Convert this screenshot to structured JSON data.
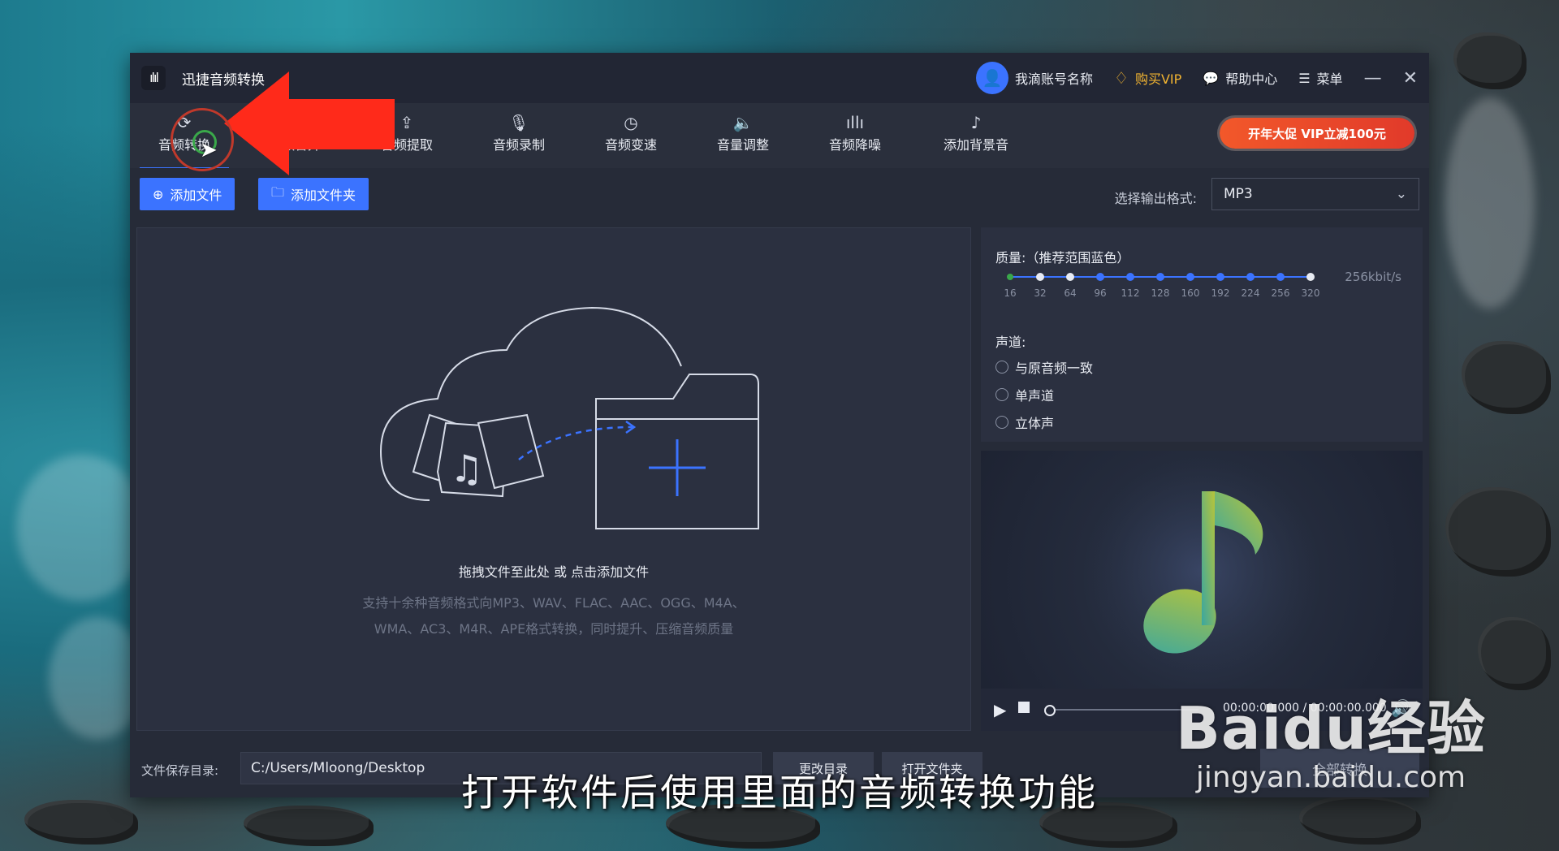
{
  "window": {
    "app_title": "迅捷音频转换",
    "account_name": "我滴账号名称",
    "vip_label": "购买VIP",
    "help_label": "帮助中心",
    "menu_label": "菜单",
    "minimize_symbol": "—",
    "close_symbol": "✕"
  },
  "toolbar": {
    "tools": [
      {
        "label": "音频转换",
        "icon": "refresh-icon"
      },
      {
        "label": "音频合并",
        "icon": "merge-icon"
      },
      {
        "label": "音频提取",
        "icon": "upload-icon"
      },
      {
        "label": "音频录制",
        "icon": "microphone-icon"
      },
      {
        "label": "音频变速",
        "icon": "speed-icon"
      },
      {
        "label": "音量调整",
        "icon": "volume-icon"
      },
      {
        "label": "音频降噪",
        "icon": "noise-icon"
      },
      {
        "label": "添加背景音",
        "icon": "music-note-icon"
      }
    ],
    "promo_label": "开年大促 VIP立减100元"
  },
  "actions": {
    "add_file": "添加文件",
    "add_folder": "添加文件夹",
    "output_format_label": "选择输出格式:",
    "output_format_value": "MP3"
  },
  "dropzone": {
    "main_text": "拖拽文件至此处 或 点击添加文件",
    "sub_line1": "支持十余种音频格式向MP3、WAV、FLAC、AAC、OGG、M4A、",
    "sub_line2": "WMA、AC3、M4R、APE格式转换，同时提升、压缩音频质量"
  },
  "settings": {
    "quality_label": "质量:（推荐范围蓝色）",
    "quality_ticks": [
      "16",
      "32",
      "64",
      "96",
      "112",
      "128",
      "160",
      "192",
      "224",
      "256",
      "320"
    ],
    "quality_value": "256kbit/s",
    "channel_label": "声道:",
    "channel_options": [
      "与原音频一致",
      "单声道",
      "立体声"
    ]
  },
  "player": {
    "time_text": "00:00:00.000 / 00:00:00.000",
    "progress": 0
  },
  "bottom": {
    "save_label": "文件保存目录:",
    "save_path": "C:/Users/Mloong/Desktop",
    "change_dir": "更改目录",
    "open_folder": "打开文件夹",
    "convert_all": "全部转换"
  },
  "overlay": {
    "subtitle": "打开软件后使用里面的音频转换功能",
    "watermark_brand": "Baidu经验",
    "watermark_site": "jingyan.baidu.com"
  },
  "colors": {
    "accent": "#3b73ff",
    "vip": "#f2b431",
    "promo": "#e13a2a",
    "annotation_arrow": "#ff2a1a"
  }
}
